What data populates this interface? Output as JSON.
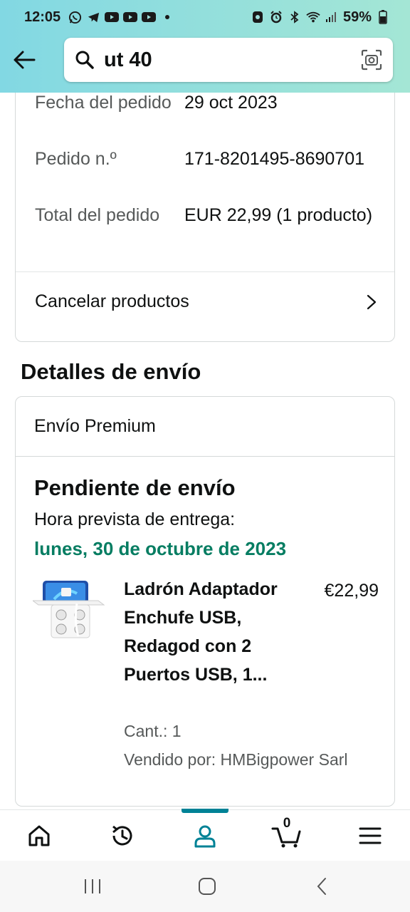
{
  "status_bar": {
    "time": "12:05",
    "battery": "59%",
    "left_icons": [
      "whatsapp-icon",
      "telegram-icon",
      "youtube-icon",
      "youtube-icon",
      "youtube-icon",
      "dot-icon"
    ],
    "right_icons": [
      "face-icon",
      "alarm-icon",
      "bluetooth-icon",
      "wifi-icon",
      "signal-icon",
      "battery-icon"
    ]
  },
  "search": {
    "value": "ut 40",
    "icon": "search-icon",
    "camera_icon": "camera-icon"
  },
  "order_info": {
    "rows": [
      {
        "label": "Fecha del pedido",
        "value": "29 oct 2023"
      },
      {
        "label": "Pedido n.º",
        "value": "171-8201495-8690701"
      },
      {
        "label": "Total del pedido",
        "value": "EUR 22,99 (1 producto)"
      }
    ],
    "cancel_label": "Cancelar productos"
  },
  "shipping": {
    "section_title": "Detalles de envío",
    "ship_type": "Envío Premium",
    "status": "Pendiente de envío",
    "eta_label": "Hora prevista de entrega:",
    "eta_date": "lunes, 30 de octubre de 2023",
    "product": {
      "title": "Ladrón Adaptador Enchufe USB, Redagod con 2 Puertos USB, 1...",
      "price": "€22,99",
      "qty": "Cant.: 1",
      "seller": "Vendido por: HMBigpower Sarl"
    }
  },
  "bottom_nav": {
    "items": [
      "home-icon",
      "history-icon",
      "account-icon",
      "cart-icon",
      "menu-icon"
    ],
    "active": "account-icon",
    "cart_count": "0"
  },
  "system_nav": [
    "recents-icon",
    "home-circle-icon",
    "back-icon"
  ],
  "colors": {
    "header_start": "#82d8e3",
    "header_end": "#a4e6d5",
    "eta_green": "#067d62",
    "active_teal": "#008296"
  }
}
